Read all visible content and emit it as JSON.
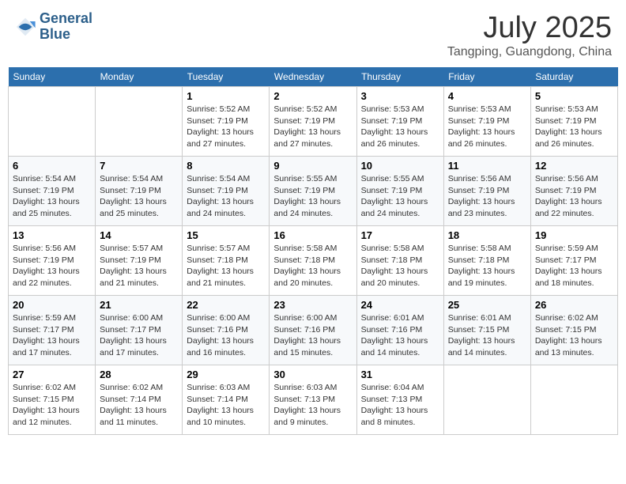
{
  "header": {
    "logo_line1": "General",
    "logo_line2": "Blue",
    "month": "July 2025",
    "location": "Tangping, Guangdong, China"
  },
  "weekdays": [
    "Sunday",
    "Monday",
    "Tuesday",
    "Wednesday",
    "Thursday",
    "Friday",
    "Saturday"
  ],
  "weeks": [
    [
      {
        "day": "",
        "info": ""
      },
      {
        "day": "",
        "info": ""
      },
      {
        "day": "1",
        "info": "Sunrise: 5:52 AM\nSunset: 7:19 PM\nDaylight: 13 hours\nand 27 minutes."
      },
      {
        "day": "2",
        "info": "Sunrise: 5:52 AM\nSunset: 7:19 PM\nDaylight: 13 hours\nand 27 minutes."
      },
      {
        "day": "3",
        "info": "Sunrise: 5:53 AM\nSunset: 7:19 PM\nDaylight: 13 hours\nand 26 minutes."
      },
      {
        "day": "4",
        "info": "Sunrise: 5:53 AM\nSunset: 7:19 PM\nDaylight: 13 hours\nand 26 minutes."
      },
      {
        "day": "5",
        "info": "Sunrise: 5:53 AM\nSunset: 7:19 PM\nDaylight: 13 hours\nand 26 minutes."
      }
    ],
    [
      {
        "day": "6",
        "info": "Sunrise: 5:54 AM\nSunset: 7:19 PM\nDaylight: 13 hours\nand 25 minutes."
      },
      {
        "day": "7",
        "info": "Sunrise: 5:54 AM\nSunset: 7:19 PM\nDaylight: 13 hours\nand 25 minutes."
      },
      {
        "day": "8",
        "info": "Sunrise: 5:54 AM\nSunset: 7:19 PM\nDaylight: 13 hours\nand 24 minutes."
      },
      {
        "day": "9",
        "info": "Sunrise: 5:55 AM\nSunset: 7:19 PM\nDaylight: 13 hours\nand 24 minutes."
      },
      {
        "day": "10",
        "info": "Sunrise: 5:55 AM\nSunset: 7:19 PM\nDaylight: 13 hours\nand 24 minutes."
      },
      {
        "day": "11",
        "info": "Sunrise: 5:56 AM\nSunset: 7:19 PM\nDaylight: 13 hours\nand 23 minutes."
      },
      {
        "day": "12",
        "info": "Sunrise: 5:56 AM\nSunset: 7:19 PM\nDaylight: 13 hours\nand 22 minutes."
      }
    ],
    [
      {
        "day": "13",
        "info": "Sunrise: 5:56 AM\nSunset: 7:19 PM\nDaylight: 13 hours\nand 22 minutes."
      },
      {
        "day": "14",
        "info": "Sunrise: 5:57 AM\nSunset: 7:19 PM\nDaylight: 13 hours\nand 21 minutes."
      },
      {
        "day": "15",
        "info": "Sunrise: 5:57 AM\nSunset: 7:18 PM\nDaylight: 13 hours\nand 21 minutes."
      },
      {
        "day": "16",
        "info": "Sunrise: 5:58 AM\nSunset: 7:18 PM\nDaylight: 13 hours\nand 20 minutes."
      },
      {
        "day": "17",
        "info": "Sunrise: 5:58 AM\nSunset: 7:18 PM\nDaylight: 13 hours\nand 20 minutes."
      },
      {
        "day": "18",
        "info": "Sunrise: 5:58 AM\nSunset: 7:18 PM\nDaylight: 13 hours\nand 19 minutes."
      },
      {
        "day": "19",
        "info": "Sunrise: 5:59 AM\nSunset: 7:17 PM\nDaylight: 13 hours\nand 18 minutes."
      }
    ],
    [
      {
        "day": "20",
        "info": "Sunrise: 5:59 AM\nSunset: 7:17 PM\nDaylight: 13 hours\nand 17 minutes."
      },
      {
        "day": "21",
        "info": "Sunrise: 6:00 AM\nSunset: 7:17 PM\nDaylight: 13 hours\nand 17 minutes."
      },
      {
        "day": "22",
        "info": "Sunrise: 6:00 AM\nSunset: 7:16 PM\nDaylight: 13 hours\nand 16 minutes."
      },
      {
        "day": "23",
        "info": "Sunrise: 6:00 AM\nSunset: 7:16 PM\nDaylight: 13 hours\nand 15 minutes."
      },
      {
        "day": "24",
        "info": "Sunrise: 6:01 AM\nSunset: 7:16 PM\nDaylight: 13 hours\nand 14 minutes."
      },
      {
        "day": "25",
        "info": "Sunrise: 6:01 AM\nSunset: 7:15 PM\nDaylight: 13 hours\nand 14 minutes."
      },
      {
        "day": "26",
        "info": "Sunrise: 6:02 AM\nSunset: 7:15 PM\nDaylight: 13 hours\nand 13 minutes."
      }
    ],
    [
      {
        "day": "27",
        "info": "Sunrise: 6:02 AM\nSunset: 7:15 PM\nDaylight: 13 hours\nand 12 minutes."
      },
      {
        "day": "28",
        "info": "Sunrise: 6:02 AM\nSunset: 7:14 PM\nDaylight: 13 hours\nand 11 minutes."
      },
      {
        "day": "29",
        "info": "Sunrise: 6:03 AM\nSunset: 7:14 PM\nDaylight: 13 hours\nand 10 minutes."
      },
      {
        "day": "30",
        "info": "Sunrise: 6:03 AM\nSunset: 7:13 PM\nDaylight: 13 hours\nand 9 minutes."
      },
      {
        "day": "31",
        "info": "Sunrise: 6:04 AM\nSunset: 7:13 PM\nDaylight: 13 hours\nand 8 minutes."
      },
      {
        "day": "",
        "info": ""
      },
      {
        "day": "",
        "info": ""
      }
    ]
  ]
}
